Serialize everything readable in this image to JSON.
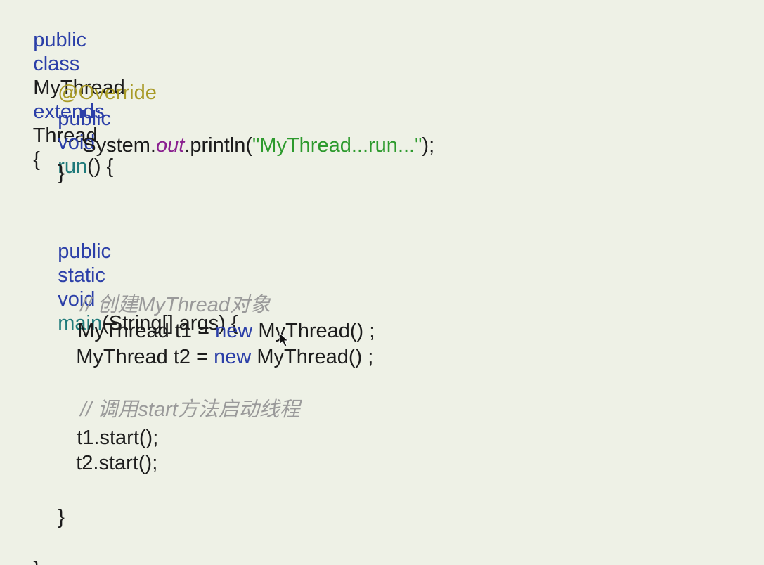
{
  "code": {
    "l1": {
      "kw1": "public",
      "kw2": "class",
      "name": "MyThread",
      "kw3": "extends",
      "base": "Thread",
      "brace": "{"
    },
    "l2": {
      "annotation": "@Override"
    },
    "l3": {
      "kw1": "public",
      "kw2": "void",
      "method": "run",
      "rest": "() {"
    },
    "l4": {
      "obj": "System.",
      "field": "out",
      "call": ".println(",
      "string": "\"MyThread...run...\"",
      "end": ");"
    },
    "l5": {
      "brace": "}"
    },
    "l6": {
      "kw1": "public",
      "kw2": "static",
      "kw3": "void",
      "method": "main",
      "rest": "(String[] args) {"
    },
    "l7": {
      "comment": "// 创建MyThread对象"
    },
    "l8": {
      "pre": "MyThread t1 = ",
      "kw": "new",
      "post": " MyThread() ;"
    },
    "l9": {
      "pre": "MyThread t2 = ",
      "kw": "new",
      "post": " MyThread() ;"
    },
    "l10": {
      "comment": "// 调用start方法启动线程"
    },
    "l11": {
      "text": "t1.start();"
    },
    "l12": {
      "text": "t2.start();"
    },
    "l13": {
      "brace": "}"
    },
    "l14": {
      "brace": "}"
    }
  },
  "colors": {
    "background": "#eef1e6",
    "keyword": "#2b3fa8",
    "annotation": "#a89a26",
    "method": "#1f7a7a",
    "field": "#8a1f8f",
    "string": "#2d9a2d",
    "comment": "#9a9a9a"
  },
  "icons": {
    "cursor": "mouse-pointer-icon"
  }
}
